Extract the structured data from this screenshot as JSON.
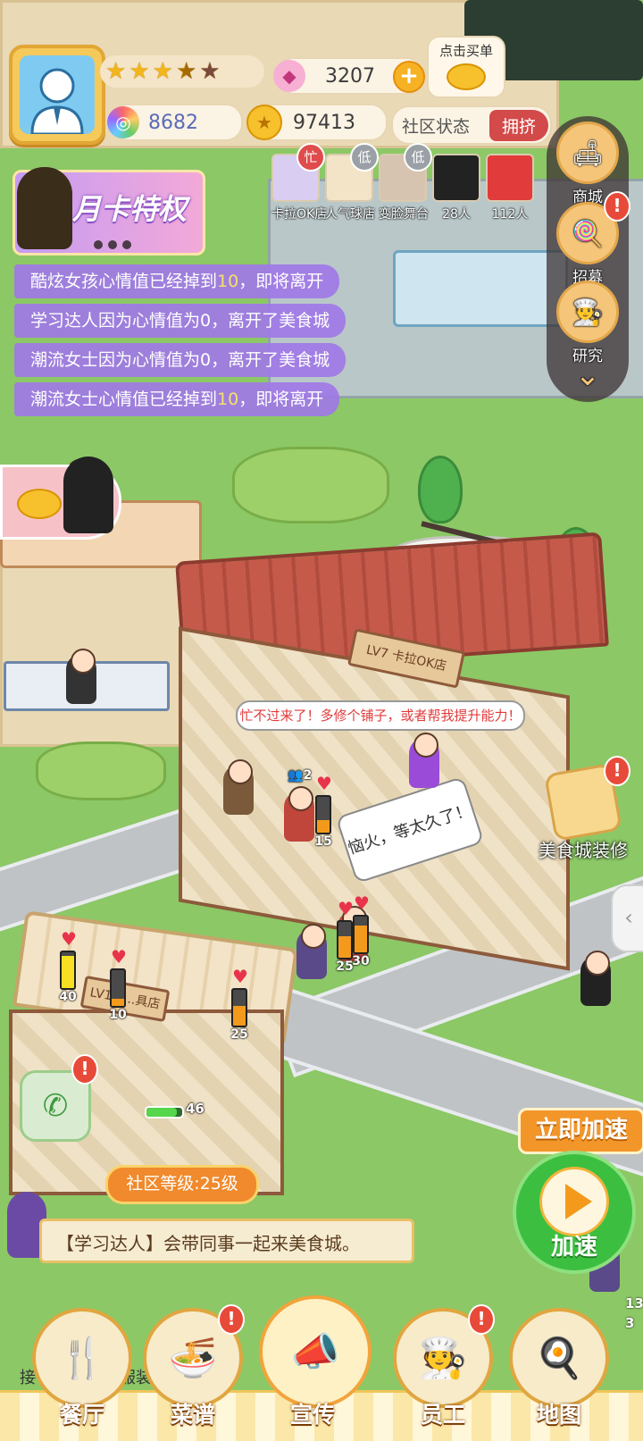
{
  "player": {
    "stars_filled": 3,
    "stars_half": 1,
    "stars_total": 5
  },
  "currency": {
    "gems": "3207",
    "tokens": "8682",
    "coins": "97413"
  },
  "buy": {
    "label": "点击买单"
  },
  "community": {
    "label": "社区状态",
    "status": "拥挤"
  },
  "shops": [
    {
      "name": "卡拉OK店",
      "tag": "忙"
    },
    {
      "name": "人气球店",
      "tag": "低"
    },
    {
      "name": "变脸舞台",
      "tag": "低"
    },
    {
      "name": "28人",
      "tag": ""
    },
    {
      "name": "112人",
      "tag": ""
    }
  ],
  "vip": {
    "title": "月卡特权"
  },
  "notifications": [
    {
      "prefix": "酷炫女孩心情值已经掉到",
      "value": "10",
      "suffix": "，即将离开"
    },
    {
      "prefix": "学习达人因为心情值为0，离开了美食城",
      "value": "",
      "suffix": ""
    },
    {
      "prefix": "潮流女士因为心情值为0，离开了美食城",
      "value": "",
      "suffix": ""
    },
    {
      "prefix": "潮流女士心情值已经掉到",
      "value": "10",
      "suffix": "，即将离开"
    }
  ],
  "side_menu": {
    "mall": "商城",
    "recruit": "招募",
    "research": "研究"
  },
  "store": {
    "sign": "LV7 卡拉OK店",
    "speech": "忙不过来了！多修个铺子，或者帮我提升能力！",
    "bubble": "恼火，等太久了！",
    "queue_count": "2"
  },
  "store2": {
    "sign": "LV17 ...具店"
  },
  "meters": [
    {
      "value": 15,
      "level": 0.35
    },
    {
      "value": 25,
      "level": 0.6
    },
    {
      "value": 30,
      "level": 0.75
    },
    {
      "value": 40,
      "level": 0.9
    },
    {
      "value": 10,
      "level": 0.2
    },
    {
      "value": 25,
      "level": 0.55
    }
  ],
  "worker_bar": {
    "value": "46"
  },
  "decorate": {
    "label": "美食城装修"
  },
  "community_level": "社区等级:25级",
  "tip": {
    "role": "【学习达人】",
    "text": "会带同事一起来美食城。"
  },
  "speed": {
    "top_label": "立即加速",
    "button_label": "加速"
  },
  "partial_texts": {
    "left_cut": "接",
    "service": "服装",
    "right_num": "13",
    "right_num2": "3"
  },
  "nav": {
    "restaurant": "餐厅",
    "recipes": "菜谱",
    "promote": "宣传",
    "staff": "员工",
    "map": "地图"
  },
  "colors": {
    "grass": "#8cc866",
    "alert_red": "#e84a3a",
    "notice_purple": "#a078e6",
    "accent_orange": "#f3962a"
  }
}
